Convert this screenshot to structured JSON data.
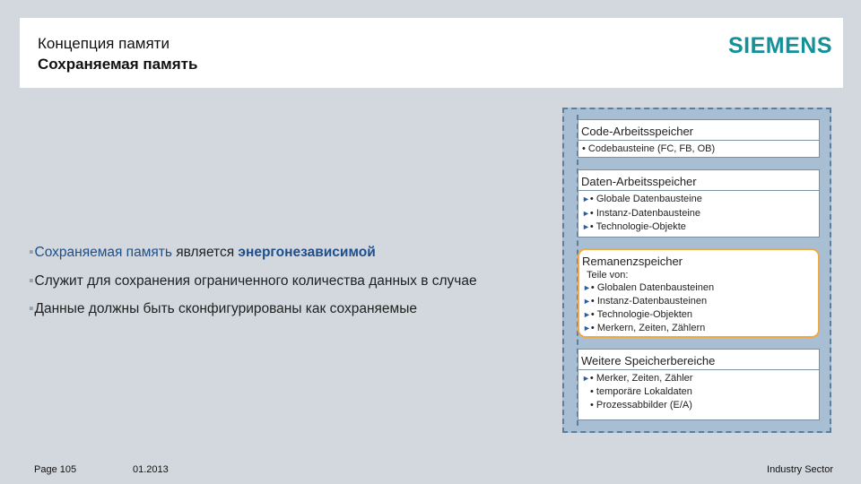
{
  "header": {
    "title": "Концепция памяти",
    "subtitle": "Сохраняемая память",
    "logo": "SIEMENS"
  },
  "bullets": [
    {
      "parts": [
        "Сохраняемая память",
        " является ",
        "энергонезависимой"
      ]
    },
    {
      "text": "Служит для сохранения ограниченного количества данных в случае"
    },
    {
      "text": "Данные должны быть сконфигурированы как сохраняемые"
    }
  ],
  "diagram": {
    "boxes": [
      {
        "title": "Code-Arbeitsspeicher",
        "items": [
          "• Codebausteine (FC, FB, OB)"
        ]
      },
      {
        "title": "Daten-Arbeitsspeicher",
        "items": [
          "• Globale Datenbausteine",
          "• Instanz-Datenbausteine",
          "• Technologie-Objekte"
        ]
      },
      {
        "title": "Remanenzspeicher",
        "subtitle": "Teile von:",
        "items": [
          "• Globalen Datenbausteinen",
          "• Instanz-Datenbausteinen",
          "• Technologie-Objekten",
          "• Merkern, Zeiten, Zählern"
        ]
      },
      {
        "title": "Weitere Speicherbereiche",
        "items": [
          "• Merker, Zeiten, Zähler",
          "• temporäre Lokaldaten",
          "• Prozessabbilder (E/A)"
        ]
      }
    ],
    "highlight_color": "#f0a848"
  },
  "footer": {
    "page": "Page 105",
    "date": "01.2013",
    "sector": "Industry Sector"
  },
  "colors": {
    "background": "#d3d8de",
    "brand": "#159098",
    "highlight_text": "#1e4f8a"
  }
}
